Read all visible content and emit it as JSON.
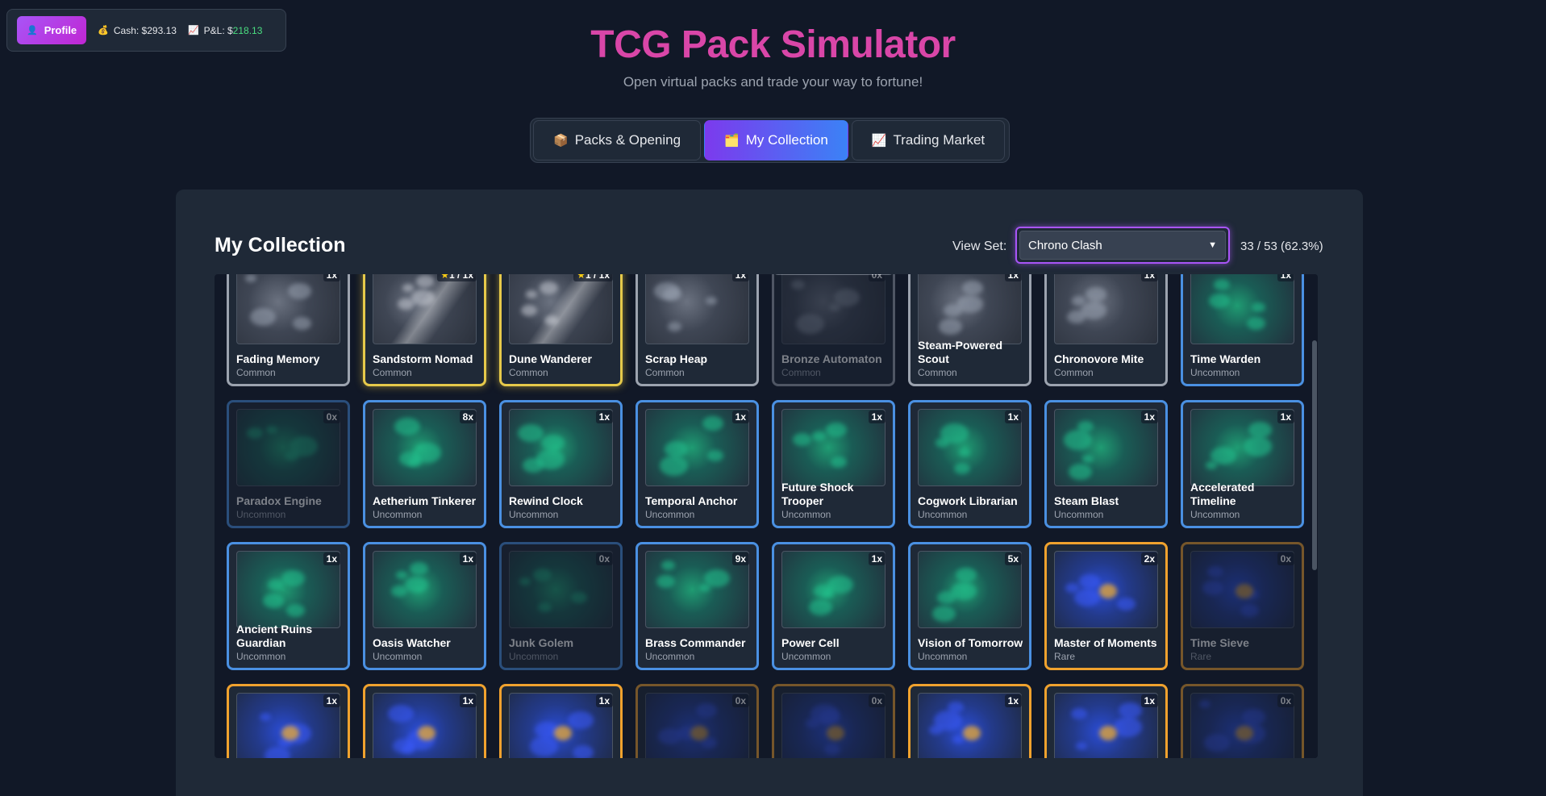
{
  "statusbar": {
    "profile_label": "Profile",
    "profile_icon": "person-icon",
    "cash_label": "Cash: $293.13",
    "pnl_prefix": "P&L: $",
    "pnl_value": "218.13"
  },
  "header": {
    "title": "TCG Pack Simulator",
    "subtitle": "Open virtual packs and trade your way to fortune!"
  },
  "tabs": [
    {
      "label": "Packs & Opening",
      "icon": "📦",
      "active": false
    },
    {
      "label": "My Collection",
      "icon": "🗂️",
      "active": true
    },
    {
      "label": "Trading Market",
      "icon": "📈",
      "active": false
    }
  ],
  "collection": {
    "title": "My Collection",
    "view_set_label": "View Set:",
    "selected_set": "Chrono Clash",
    "count_text": "33 / 53 (62.3%)"
  },
  "colors": {
    "accent": "#a855f7",
    "title": "#d946a8",
    "common_border": "#9ca3af",
    "uncommon_border": "#4a90e2",
    "rare_border": "#f0a22e",
    "positive": "#4ade80"
  },
  "partial_top_row": [
    "common",
    "gold",
    "common",
    "gold",
    "common",
    "common",
    "common",
    "common"
  ],
  "cards": [
    {
      "name": "Fading Memory",
      "rarity": "Common",
      "qty": "1x",
      "tier": "common",
      "owned": true
    },
    {
      "name": "Sandstorm Nomad",
      "rarity": "Common",
      "qty": "1 / 1x",
      "star": true,
      "tier": "gold",
      "owned": true
    },
    {
      "name": "Dune Wanderer",
      "rarity": "Common",
      "qty": "1 / 1x",
      "star": true,
      "tier": "gold",
      "owned": true
    },
    {
      "name": "Scrap Heap",
      "rarity": "Common",
      "qty": "1x",
      "tier": "common",
      "owned": true
    },
    {
      "name": "Bronze Automaton",
      "rarity": "Common",
      "qty": "0x",
      "tier": "common",
      "owned": false
    },
    {
      "name": "Steam-Powered Scout",
      "rarity": "Common",
      "qty": "1x",
      "tier": "common",
      "owned": true
    },
    {
      "name": "Chronovore Mite",
      "rarity": "Common",
      "qty": "1x",
      "tier": "common",
      "owned": true
    },
    {
      "name": "Time Warden",
      "rarity": "Uncommon",
      "qty": "1x",
      "tier": "uncommon",
      "owned": true
    },
    {
      "name": "Paradox Engine",
      "rarity": "Uncommon",
      "qty": "0x",
      "tier": "uncommon",
      "owned": false
    },
    {
      "name": "Aetherium Tinkerer",
      "rarity": "Uncommon",
      "qty": "8x",
      "tier": "uncommon",
      "owned": true
    },
    {
      "name": "Rewind Clock",
      "rarity": "Uncommon",
      "qty": "1x",
      "tier": "uncommon",
      "owned": true
    },
    {
      "name": "Temporal Anchor",
      "rarity": "Uncommon",
      "qty": "1x",
      "tier": "uncommon",
      "owned": true
    },
    {
      "name": "Future Shock Trooper",
      "rarity": "Uncommon",
      "qty": "1x",
      "tier": "uncommon",
      "owned": true
    },
    {
      "name": "Cogwork Librarian",
      "rarity": "Uncommon",
      "qty": "1x",
      "tier": "uncommon",
      "owned": true
    },
    {
      "name": "Steam Blast",
      "rarity": "Uncommon",
      "qty": "1x",
      "tier": "uncommon",
      "owned": true
    },
    {
      "name": "Accelerated Timeline",
      "rarity": "Uncommon",
      "qty": "1x",
      "tier": "uncommon",
      "owned": true
    },
    {
      "name": "Ancient Ruins Guardian",
      "rarity": "Uncommon",
      "qty": "1x",
      "tier": "uncommon",
      "owned": true
    },
    {
      "name": "Oasis Watcher",
      "rarity": "Uncommon",
      "qty": "1x",
      "tier": "uncommon",
      "owned": true
    },
    {
      "name": "Junk Golem",
      "rarity": "Uncommon",
      "qty": "0x",
      "tier": "uncommon",
      "owned": false
    },
    {
      "name": "Brass Commander",
      "rarity": "Uncommon",
      "qty": "9x",
      "tier": "uncommon",
      "owned": true
    },
    {
      "name": "Power Cell",
      "rarity": "Uncommon",
      "qty": "1x",
      "tier": "uncommon",
      "owned": true
    },
    {
      "name": "Vision of Tomorrow",
      "rarity": "Uncommon",
      "qty": "5x",
      "tier": "uncommon",
      "owned": true
    },
    {
      "name": "Master of Moments",
      "rarity": "Rare",
      "qty": "2x",
      "tier": "rare",
      "owned": true
    },
    {
      "name": "Time Sieve",
      "rarity": "Rare",
      "qty": "0x",
      "tier": "rare",
      "owned": false
    },
    {
      "name": "",
      "rarity": "",
      "qty": "1x",
      "tier": "rare",
      "owned": true
    },
    {
      "name": "",
      "rarity": "",
      "qty": "1x",
      "tier": "rare",
      "owned": true
    },
    {
      "name": "",
      "rarity": "",
      "qty": "1x",
      "tier": "rare",
      "owned": true
    },
    {
      "name": "",
      "rarity": "",
      "qty": "0x",
      "tier": "rare",
      "owned": false
    },
    {
      "name": "",
      "rarity": "",
      "qty": "0x",
      "tier": "rare",
      "owned": false
    },
    {
      "name": "",
      "rarity": "",
      "qty": "1x",
      "tier": "rare",
      "owned": true
    },
    {
      "name": "",
      "rarity": "",
      "qty": "1x",
      "tier": "rare",
      "owned": true
    },
    {
      "name": "",
      "rarity": "",
      "qty": "0x",
      "tier": "rare",
      "owned": false
    }
  ]
}
